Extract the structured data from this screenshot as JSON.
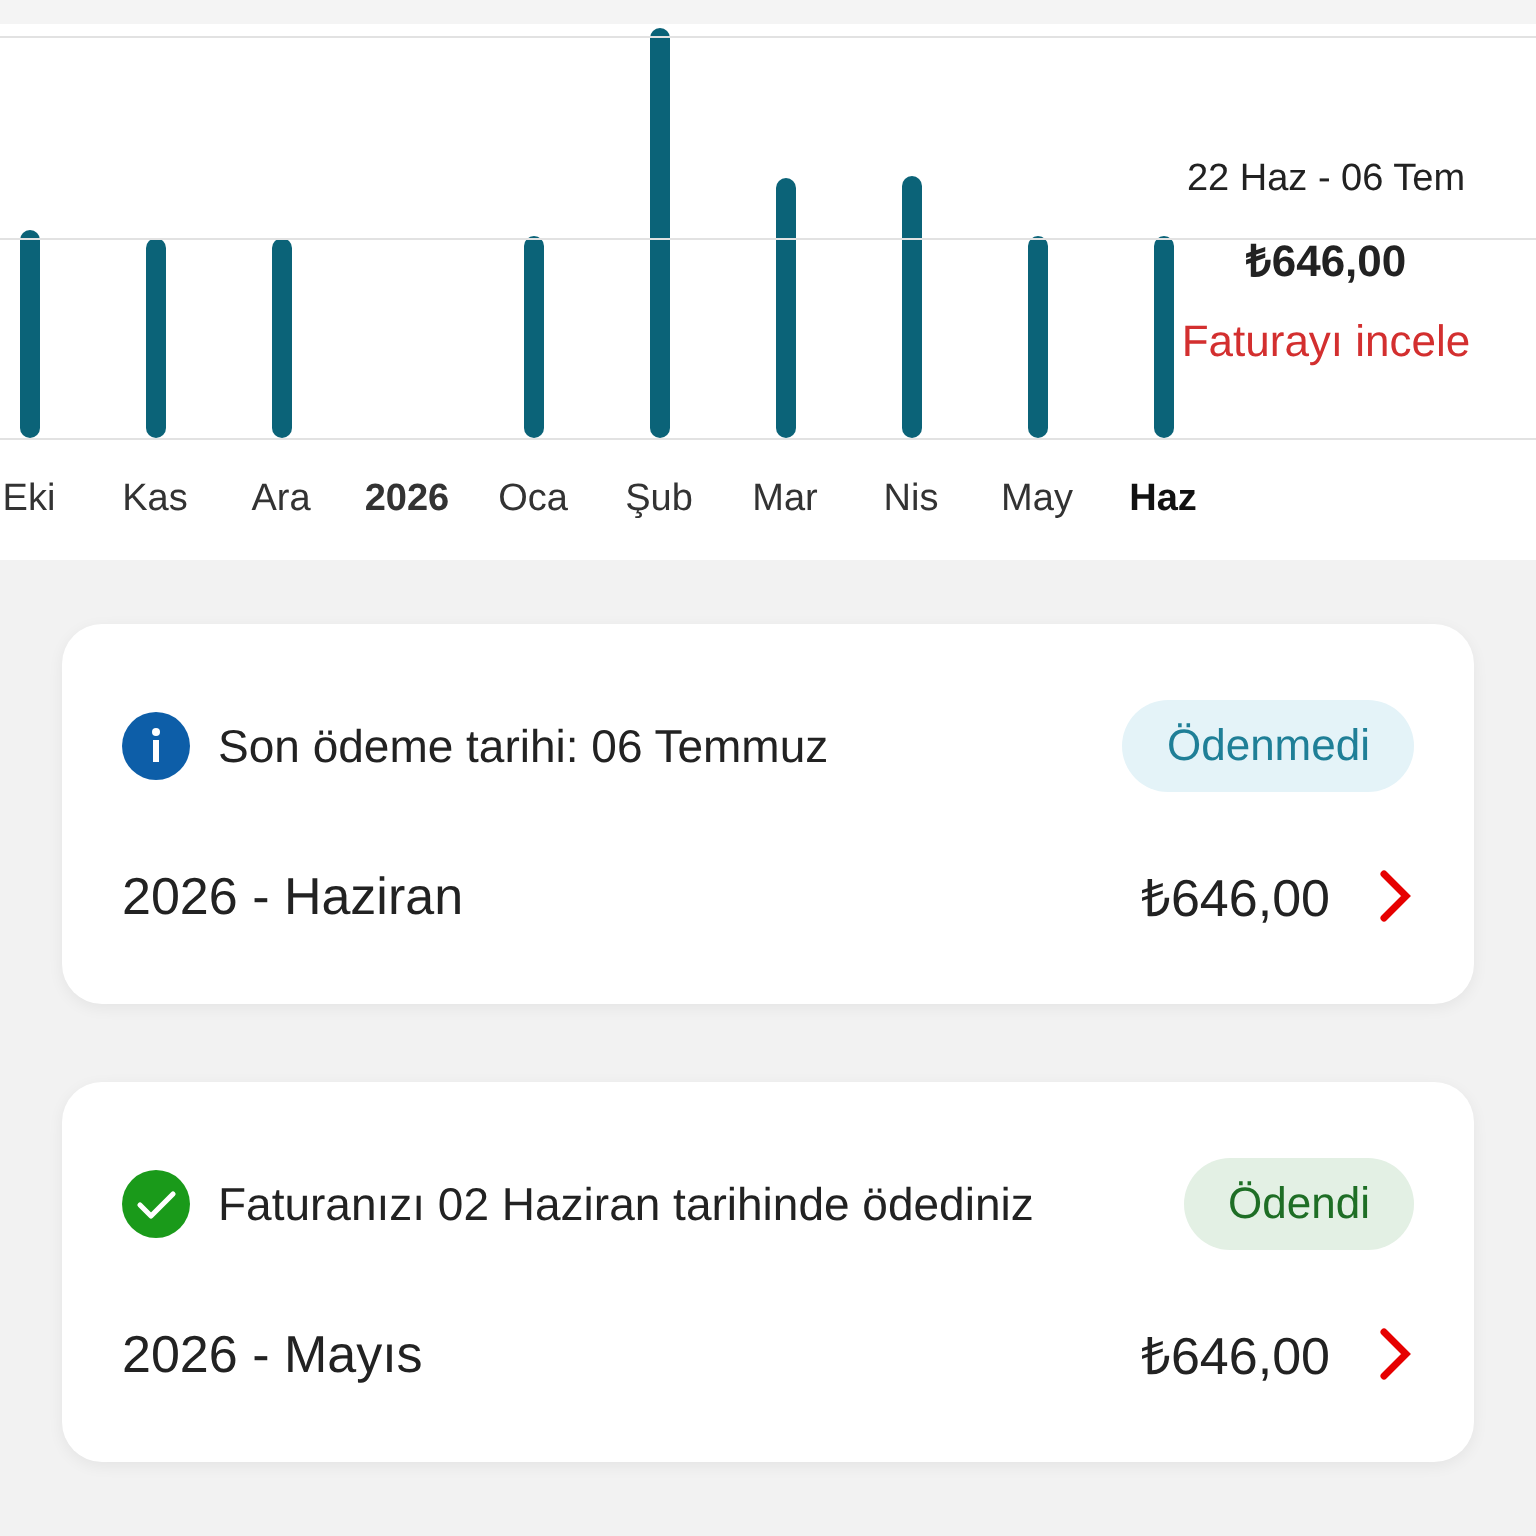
{
  "chart": {
    "labels": [
      {
        "text": "Eki",
        "kind": "month",
        "selected": false
      },
      {
        "text": "Kas",
        "kind": "month",
        "selected": false
      },
      {
        "text": "Ara",
        "kind": "month",
        "selected": false
      },
      {
        "text": "2026",
        "kind": "year",
        "selected": false
      },
      {
        "text": "Oca",
        "kind": "month",
        "selected": false
      },
      {
        "text": "Şub",
        "kind": "month",
        "selected": false
      },
      {
        "text": "Mar",
        "kind": "month",
        "selected": false
      },
      {
        "text": "Nis",
        "kind": "month",
        "selected": false
      },
      {
        "text": "May",
        "kind": "month",
        "selected": false
      },
      {
        "text": "Haz",
        "kind": "month",
        "selected": true
      }
    ],
    "summary": {
      "period": "22 Haz - 06 Tem",
      "amount": "₺646,00",
      "link": "Faturayı incele"
    }
  },
  "bills": [
    {
      "kind": "unpaid",
      "message": "Son ödeme tarihi: 06 Temmuz",
      "status": "Ödenmedi",
      "period": "2026 - Haziran",
      "amount": "₺646,00"
    },
    {
      "kind": "paid",
      "message": "Faturanızı 02 Haziran tarihinde ödediniz",
      "status": "Ödendi",
      "period": "2026 - Mayıs",
      "amount": "₺646,00"
    }
  ]
}
